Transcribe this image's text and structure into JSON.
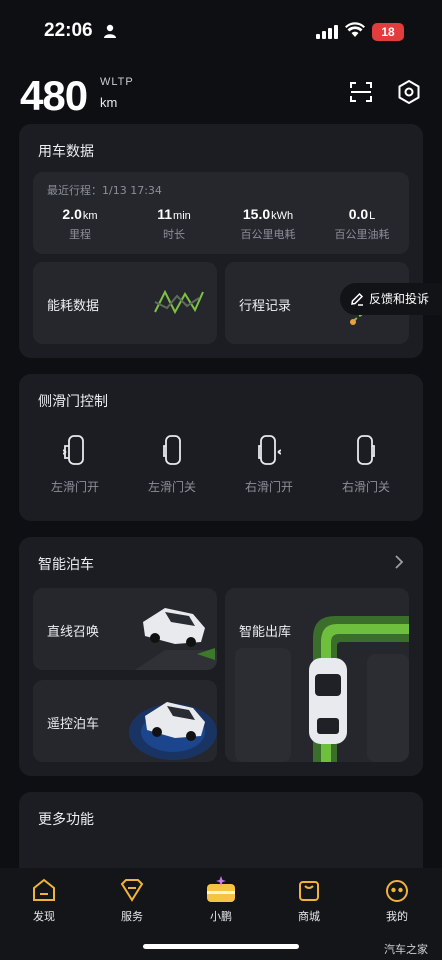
{
  "status_bar": {
    "time": "22:06",
    "battery": "18"
  },
  "header": {
    "range_value": "480",
    "range_unit": "km",
    "range_standard": "WLTP"
  },
  "vehicle_data": {
    "title": "用车数据",
    "recent_trip": "最近行程：1/13 17:34",
    "stats": [
      {
        "value": "2.0",
        "unit": "km",
        "label": "里程"
      },
      {
        "value": "11",
        "unit": "min",
        "label": "时长"
      },
      {
        "value": "15.0",
        "unit": "kWh",
        "label": "百公里电耗"
      },
      {
        "value": "0.0",
        "unit": "L",
        "label": "百公里油耗"
      }
    ],
    "energy_tile": "能耗数据",
    "trip_tile": "行程记录"
  },
  "feedback": {
    "label": "反馈和投诉"
  },
  "sliding_door": {
    "title": "侧滑门控制",
    "buttons": [
      "左滑门开",
      "左滑门关",
      "右滑门开",
      "右滑门关"
    ]
  },
  "smart_parking": {
    "title": "智能泊车",
    "summon": "直线召唤",
    "remote": "遥控泊车",
    "exit": "智能出库"
  },
  "more": {
    "title": "更多功能"
  },
  "nav": {
    "items": [
      "发现",
      "服务",
      "小鹏",
      "商城",
      "我的"
    ]
  },
  "watermark": "汽车之家",
  "colors": {
    "accent_green": "#7dc242",
    "card_bg": "#1c1d22",
    "tile_bg": "#25272d",
    "battery_red": "#e23c3c"
  }
}
